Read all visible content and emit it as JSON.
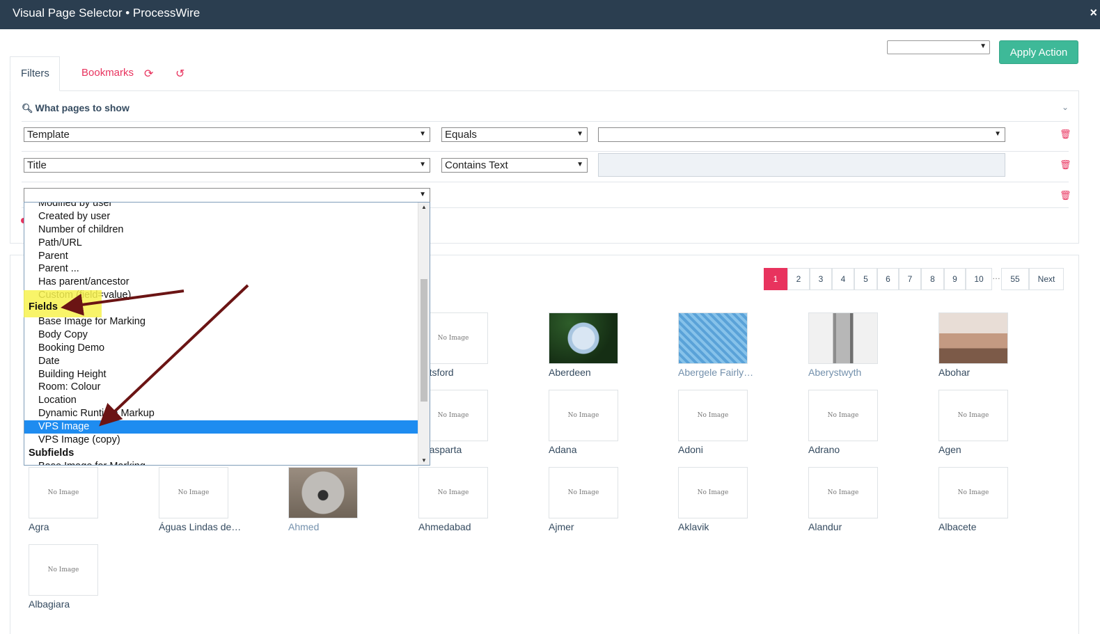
{
  "window": {
    "title": "Visual Page Selector • ProcessWire",
    "close_icon": "×"
  },
  "toolbar": {
    "action_select_value": "",
    "apply_label": "Apply Action"
  },
  "tabs": {
    "filters": "Filters",
    "bookmarks": "Bookmarks",
    "refresh_icon": "⟳",
    "reset_icon": "↺"
  },
  "filters": {
    "heading": "What pages to show",
    "rows": [
      {
        "field": "Template",
        "operator": "Equals",
        "value": ""
      },
      {
        "field": "Title",
        "operator": "Contains Text",
        "value": ""
      },
      {
        "field": "",
        "operator": "",
        "value": ""
      }
    ]
  },
  "dropdown": {
    "items": [
      {
        "label": "Modified by user",
        "type": "item"
      },
      {
        "label": "Created by user",
        "type": "item"
      },
      {
        "label": "Number of children",
        "type": "item"
      },
      {
        "label": "Path/URL",
        "type": "item"
      },
      {
        "label": "Parent",
        "type": "item"
      },
      {
        "label": "Parent ...",
        "type": "item"
      },
      {
        "label": "Has parent/ancestor",
        "type": "item"
      },
      {
        "label": "Custom (field=value)",
        "type": "item"
      },
      {
        "label": "Fields",
        "type": "group"
      },
      {
        "label": "Base Image for Marking",
        "type": "item"
      },
      {
        "label": "Body Copy",
        "type": "item"
      },
      {
        "label": "Booking Demo",
        "type": "item"
      },
      {
        "label": "Date",
        "type": "item"
      },
      {
        "label": "Building Height",
        "type": "item"
      },
      {
        "label": "Room: Colour",
        "type": "item"
      },
      {
        "label": "Location",
        "type": "item"
      },
      {
        "label": "Dynamic Runtime Markup",
        "type": "item"
      },
      {
        "label": "VPS Image",
        "type": "selected"
      },
      {
        "label": "VPS Image (copy)",
        "type": "item"
      },
      {
        "label": "Subfields",
        "type": "group"
      },
      {
        "label": "Base Image for Marking",
        "type": "item"
      }
    ]
  },
  "pagination": {
    "pages": [
      "1",
      "2",
      "3",
      "4",
      "5",
      "6",
      "7",
      "8",
      "9",
      "10"
    ],
    "ellipsis": "…",
    "last": "55",
    "next": "Next",
    "current": "1"
  },
  "results": {
    "no_image_text": "No Image",
    "cards": [
      {
        "name": "botsford",
        "image": "none",
        "linked": false
      },
      {
        "name": "Aberdeen",
        "image": "hydrangea",
        "linked": false
      },
      {
        "name": "Abergele Fairly…",
        "image": "pool",
        "linked": true
      },
      {
        "name": "Aberystwyth",
        "image": "flatiron",
        "linked": true
      },
      {
        "name": "Abohar",
        "image": "abohar",
        "linked": false
      },
      {
        "name": "quasparta",
        "image": "none",
        "linked": false
      },
      {
        "name": "Adana",
        "image": "none",
        "linked": false
      },
      {
        "name": "Adoni",
        "image": "none",
        "linked": false
      },
      {
        "name": "Adrano",
        "image": "none",
        "linked": false
      },
      {
        "name": "Agen",
        "image": "none",
        "linked": false
      },
      {
        "name": "Agra",
        "image": "none",
        "linked": false
      },
      {
        "name": "Águas Lindas de…",
        "image": "none",
        "linked": false
      },
      {
        "name": "Ahmed",
        "image": "koala",
        "linked": true
      },
      {
        "name": "Ahmedabad",
        "image": "none",
        "linked": false
      },
      {
        "name": "Ajmer",
        "image": "none",
        "linked": false
      },
      {
        "name": "Aklavik",
        "image": "none",
        "linked": false
      },
      {
        "name": "Alandur",
        "image": "none",
        "linked": false
      },
      {
        "name": "Albacete",
        "image": "none",
        "linked": false
      },
      {
        "name": "Albagiara",
        "image": "none",
        "linked": false
      }
    ]
  },
  "colors": {
    "accent": "#e8335e",
    "apply": "#3eb998",
    "titlebar": "#2b3e50",
    "selected_option": "#1e8cf0",
    "annotation_arrow": "#6b1414",
    "highlight": "#f7f24f"
  }
}
